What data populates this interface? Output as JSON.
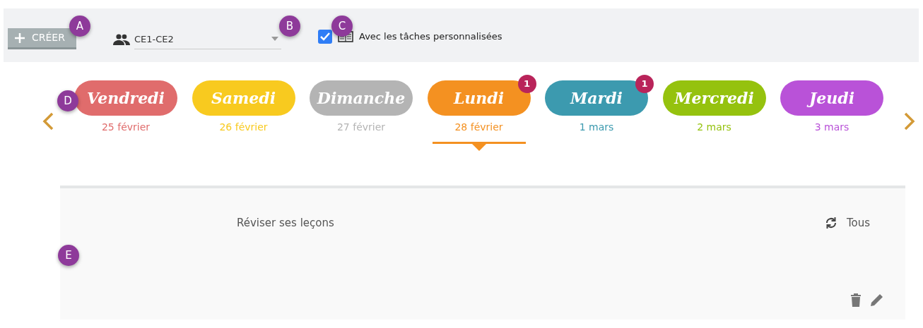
{
  "toolbar": {
    "create_button": {
      "label": "CRÉER"
    },
    "group_select": {
      "value": "CE1-CE2"
    },
    "custom_tasks": {
      "label": "Avec les tâches personnalisées",
      "checked": true
    }
  },
  "days": [
    {
      "name": "Vendredi",
      "date": "25 février",
      "color": "#e06c6c",
      "selected": false
    },
    {
      "name": "Samedi",
      "date": "26 février",
      "color": "#f8ca1f",
      "selected": false
    },
    {
      "name": "Dimanche",
      "date": "27 février",
      "color": "#b4b4b4",
      "selected": false
    },
    {
      "name": "Lundi",
      "date": "28 février",
      "color": "#f49121",
      "selected": true,
      "badge": "1"
    },
    {
      "name": "Mardi",
      "date": "1 mars",
      "color": "#3c9aaf",
      "selected": false,
      "badge": "1"
    },
    {
      "name": "Mercredi",
      "date": "2 mars",
      "color": "#95c20e",
      "selected": false
    },
    {
      "name": "Jeudi",
      "date": "3 mars",
      "color": "#b952d8",
      "selected": false
    }
  ],
  "task": {
    "title": "Réviser ses leçons",
    "recurrence": "Tous"
  },
  "callouts": [
    "A",
    "B",
    "C",
    "D",
    "E"
  ]
}
